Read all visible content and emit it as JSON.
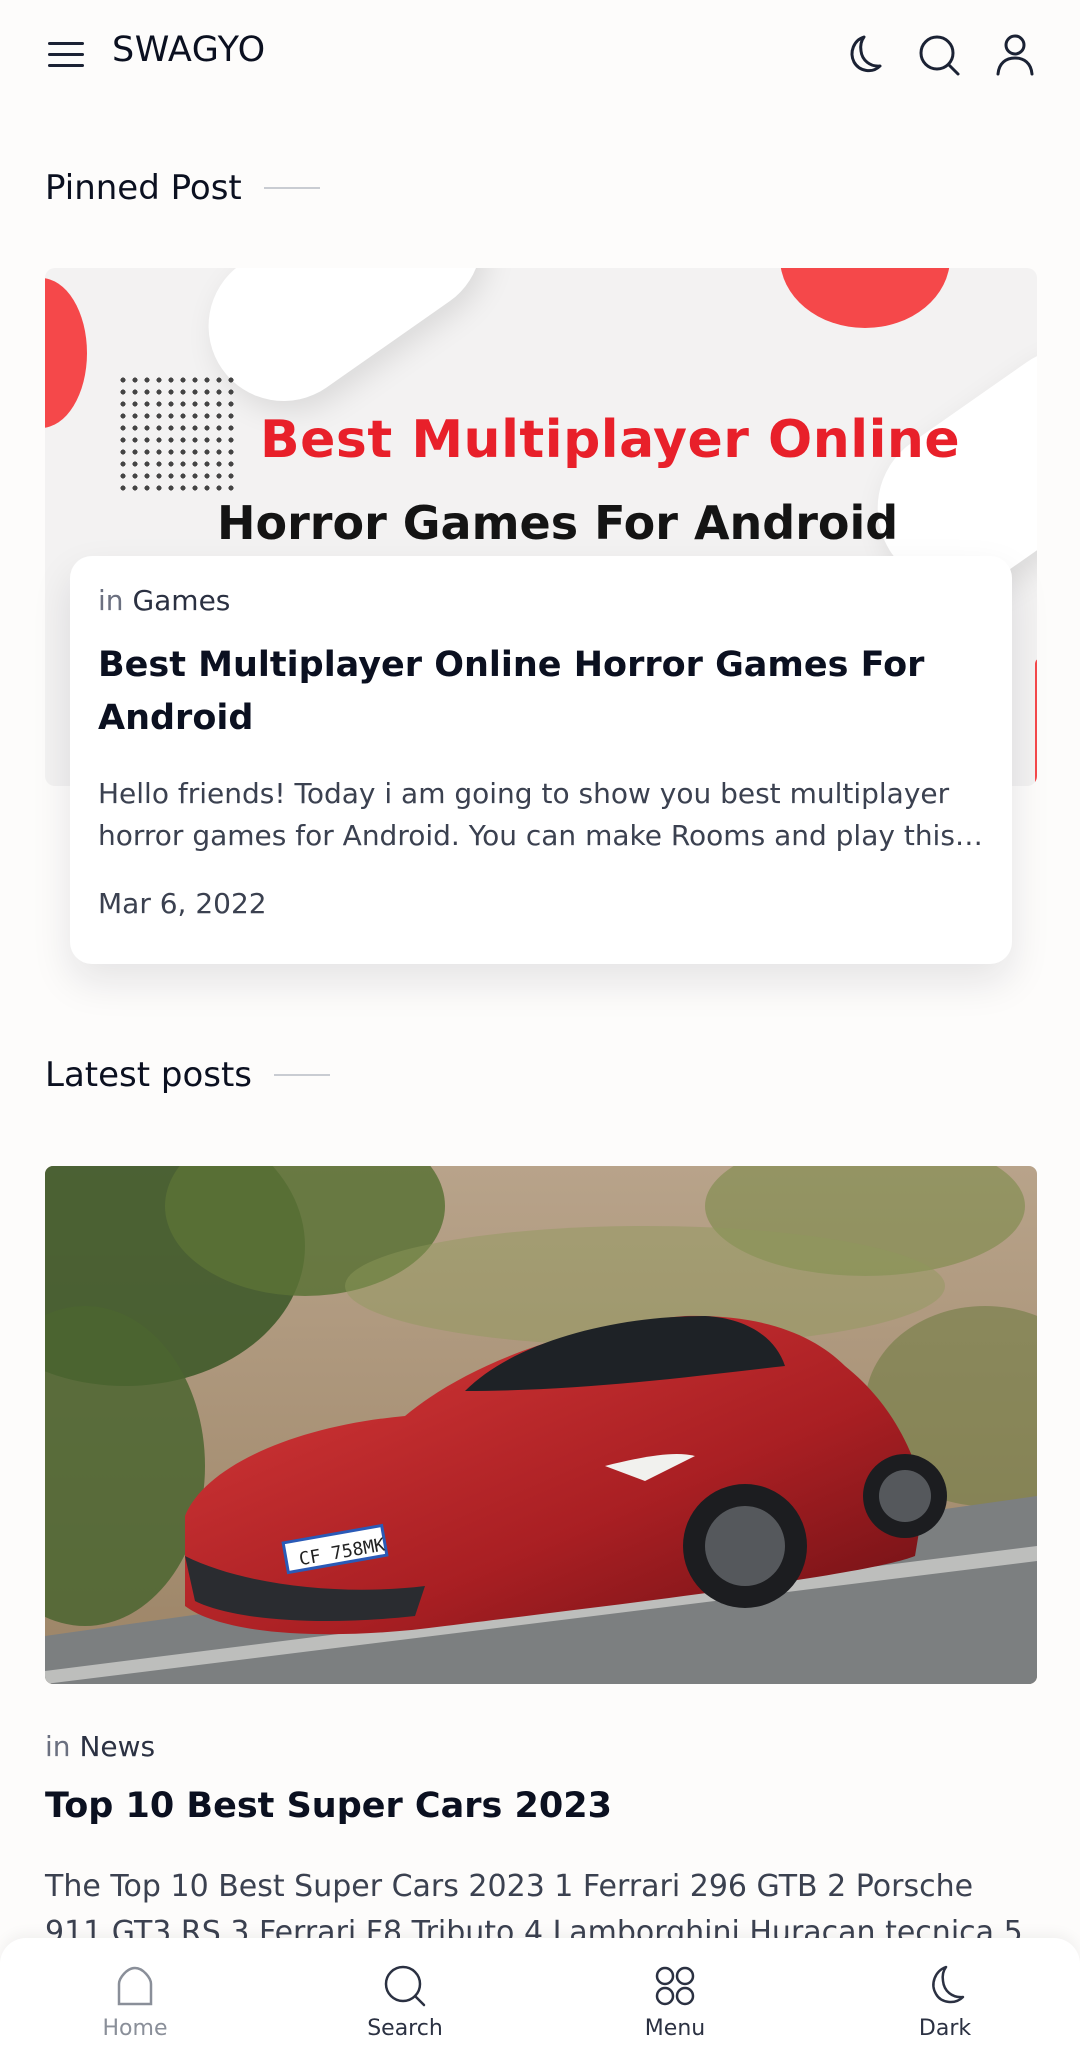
{
  "header": {
    "brand": "SWAGYO",
    "icons": [
      "menu-icon",
      "moon-icon",
      "search-icon",
      "user-icon"
    ]
  },
  "pinned": {
    "section_title": "Pinned Post",
    "banner_line1": "Best Multiplayer Online",
    "banner_line2": "Horror Games For Android",
    "category_prefix": "in",
    "category": "Games",
    "title": "Best Multiplayer Online Horror Games For Android",
    "excerpt": "Hello friends! Today i am going to show you best multiplayer horror games for Android. You can make Rooms and play this…",
    "date": "Mar 6, 2022"
  },
  "latest": {
    "section_title": "Latest posts",
    "category_prefix": "in",
    "category": "News",
    "title": "Top 10 Best Super Cars 2023",
    "excerpt": "The Top 10 Best Super Cars 2023 1   Ferrari 296 GTB 2 Porsche 911 GT3 RS 3 Ferrari F8 Tributo 4 Lamborghini Huracan tecnica 5"
  },
  "bottom_nav": {
    "items": [
      {
        "label": "Home",
        "icon": "home-icon",
        "active": true
      },
      {
        "label": "Search",
        "icon": "search-icon"
      },
      {
        "label": "Menu",
        "icon": "grid-icon"
      },
      {
        "label": "Dark",
        "icon": "moon-icon"
      }
    ]
  },
  "colors": {
    "accent_red": "#e8202a",
    "background": "#fdfcfb",
    "text_dark": "#0b1020",
    "text_muted": "#6b7080"
  }
}
